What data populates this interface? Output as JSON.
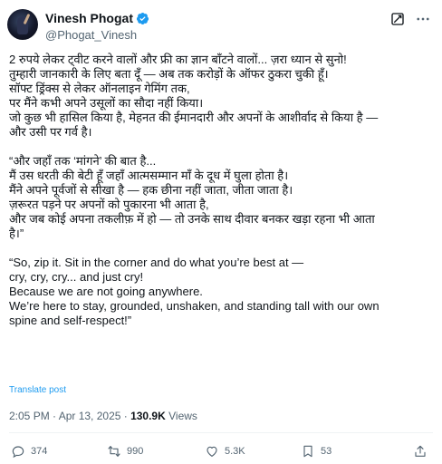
{
  "author": {
    "name": "Vinesh Phogat",
    "handle": "@Phogat_Vinesh"
  },
  "tweet": {
    "lines": [
      "2 रुपये लेकर ट्वीट करने वालों और फ्री का ज्ञान बाँटने वालों... ज़रा ध्यान से सुनो!",
      "तुम्हारी जानकारी के लिए बता दूँ — अब तक करोड़ों के ऑफर ठुकरा चुकी हूँ।",
      "सॉफ्ट ड्रिंक्स से लेकर ऑनलाइन गेमिंग तक,",
      "पर मैंने कभी अपने उसूलों का सौदा नहीं किया।",
      "जो कुछ भी हासिल किया है, मेहनत की ईमानदारी और अपनों के आशीर्वाद से किया है —",
      "और उसी पर गर्व है।",
      "",
      "“और जहाँ तक ‘मांगने’ की बात है...",
      "मैं उस धरती की बेटी हूँ जहाँ आत्मसम्मान माँ के दूध में घुला होता है।",
      "मैंने अपने पूर्वजों से सीखा है — हक छीना नहीं जाता, जीता जाता है।",
      "ज़रूरत पड़ने पर अपनों को पुकारना भी आता है,",
      "और जब कोई अपना तकलीफ़ में हो — तो उनके साथ दीवार बनकर खड़ा रहना भी आता",
      "है।”",
      "",
      "“So, zip it. Sit in the corner and do what you’re best at —",
      "cry, cry, cry... and just cry!",
      "Because we are not going anywhere.",
      "We’re here to stay, grounded, unshaken, and standing tall with our own",
      "spine and self-respect!”"
    ],
    "translate_label": "Translate post"
  },
  "meta": {
    "time": "2:05 PM · Apr 13, 2025 · ",
    "views_count": "130.9K",
    "views_label": " Views"
  },
  "actions": {
    "replies": "374",
    "reposts": "990",
    "likes": "5.3K",
    "bookmarks": "53"
  },
  "colors": {
    "verified": "#1d9bf0",
    "link": "#1d9bf0",
    "muted": "#536471"
  }
}
